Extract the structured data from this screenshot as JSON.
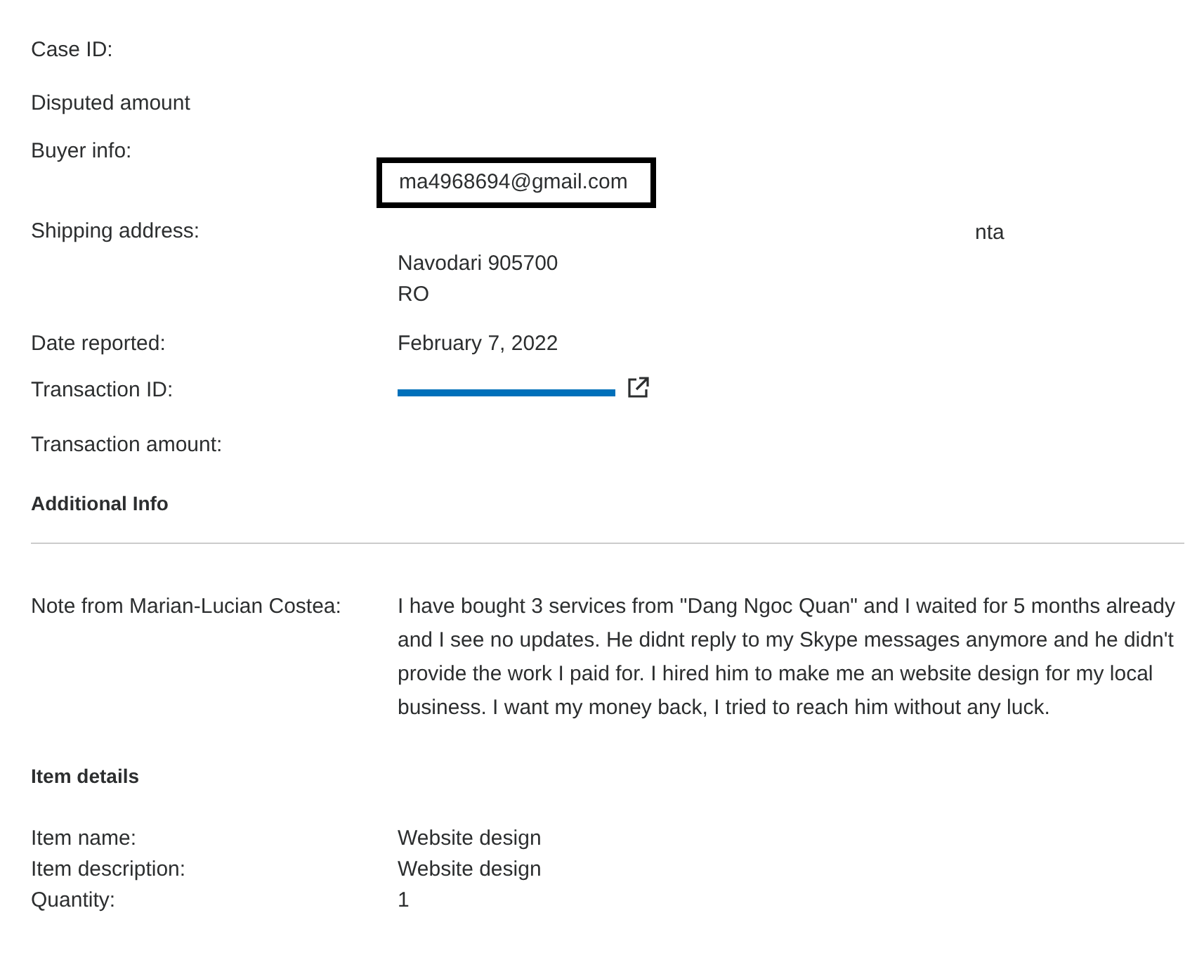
{
  "case_fields": [
    {
      "label": "Case ID:"
    },
    {
      "label": "Disputed amount"
    },
    {
      "label": "Buyer info:",
      "email": "ma4968694@gmail.com"
    },
    {
      "label": "Shipping address:",
      "address_lines": [
        "nta",
        "Navodari 905700",
        "RO"
      ]
    },
    {
      "label": "Date reported:",
      "value": "February 7, 2022"
    },
    {
      "label": "Transaction ID:",
      "link_redacted": true
    },
    {
      "label": "Transaction amount:"
    }
  ],
  "additional_info": {
    "heading": "Additional Info",
    "note_label": "Note from Marian-Lucian Costea:",
    "note": "I have bought 3 services from \"Dang Ngoc Quan\" and I waited for 5 months already and I see no updates. He didnt reply to my Skype messages anymore and he didn't provide the work I paid for. I hired him to make me an website design for my local business. I want my money back, I tried to reach him without any luck."
  },
  "item_details": {
    "heading": "Item details",
    "rows": [
      {
        "label": "Item name:",
        "value": "Website design"
      },
      {
        "label": "Item description:",
        "value": "Website design"
      },
      {
        "label": "Quantity:",
        "value": "1"
      }
    ]
  }
}
